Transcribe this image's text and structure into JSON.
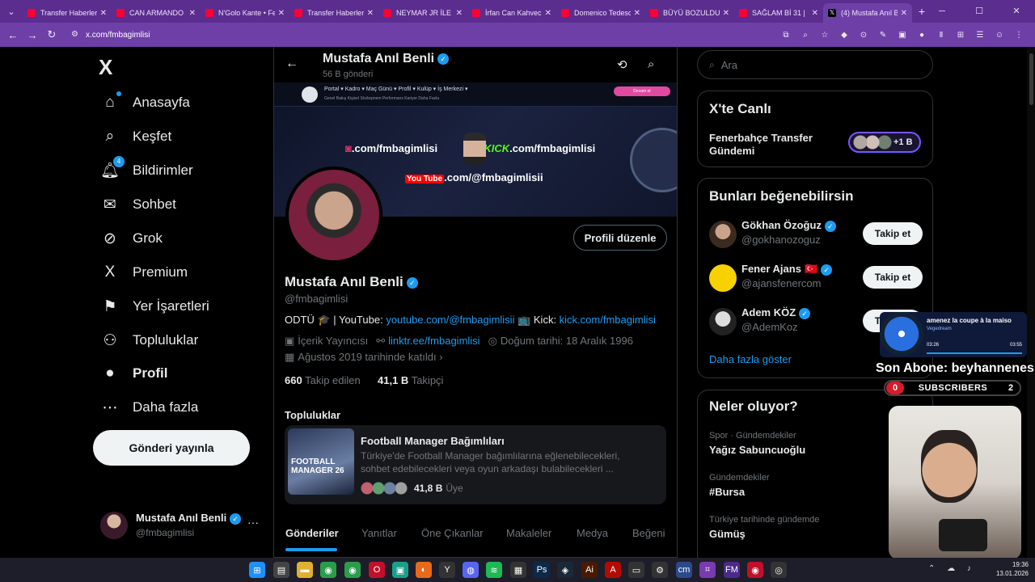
{
  "browser": {
    "tabs": [
      {
        "title": "Transfer Haberleri",
        "icon": "youtube-icon"
      },
      {
        "title": "CAN ARMANDO",
        "icon": "youtube-icon"
      },
      {
        "title": "N'Golo Kante • Fe",
        "icon": "youtube-icon"
      },
      {
        "title": "Transfer Haberleri",
        "icon": "youtube-icon"
      },
      {
        "title": "NEYMAR JR İLE B",
        "icon": "youtube-icon"
      },
      {
        "title": "İrfan Can Kahveci",
        "icon": "youtube-icon"
      },
      {
        "title": "Domenico Tedesc",
        "icon": "youtube-icon"
      },
      {
        "title": "BÜYÜ BOZULDU",
        "icon": "youtube-icon"
      },
      {
        "title": "SAĞLAM Bİ 31 |",
        "icon": "youtube-icon"
      },
      {
        "title": "(4) Mustafa Anıl B",
        "icon": "x-icon"
      }
    ],
    "active_tab": 9,
    "url": "x.com/fmbagimlisi",
    "accent": "#6f3fa8"
  },
  "sidebar": {
    "logo": "X",
    "items": [
      {
        "label": "Anasayfa",
        "icon": "home-icon"
      },
      {
        "label": "Keşfet",
        "icon": "search-icon"
      },
      {
        "label": "Bildirimler",
        "icon": "bell-icon",
        "badge": "4"
      },
      {
        "label": "Sohbet",
        "icon": "mail-icon"
      },
      {
        "label": "Grok",
        "icon": "grok-icon"
      },
      {
        "label": "Premium",
        "icon": "x-icon"
      },
      {
        "label": "Yer İşaretleri",
        "icon": "bookmark-icon"
      },
      {
        "label": "Topluluklar",
        "icon": "people-icon"
      },
      {
        "label": "Profil",
        "icon": "person-icon"
      },
      {
        "label": "Daha fazla",
        "icon": "more-circle-icon"
      }
    ],
    "post_button": "Gönderi yayınla",
    "account": {
      "name": "Mustafa Anıl Benli",
      "handle": "@fmbagimlisi",
      "more": "···"
    }
  },
  "profile": {
    "header_name": "Mustafa Anıl Benli",
    "post_count": "56 B gönderi",
    "banner": {
      "menu": "Portal ▾   Kadro ▾   Maç Günü ▾   Profil ▾   Kulüp ▾   İş Merkezi ▾",
      "submenu": "Genel Bakış   Kişisel   Sözleşmem   Performans   Kariyer   Daha Fazla",
      "button": "Devam et",
      "instagram": ".com/fmbagimlisi",
      "kick_brand": "KICK",
      "kick": ".com/fmbagimlisi",
      "youtube_brand": "You Tube",
      "youtube": ".com/@fmbagimlisii"
    },
    "edit_button": "Profili düzenle",
    "name": "Mustafa Anıl Benli",
    "handle": "@fmbagimlisi",
    "bio_prefix": "ODTÜ 🎓 | YouTube: ",
    "bio_youtube": "youtube.com/@fmbagimlisii",
    "bio_mid": " 📺 Kick: ",
    "bio_kick": "kick.com/fmbagimlisi",
    "category": "İçerik Yayıncısı",
    "link": "linktr.ee/fmbagimlisi",
    "birthday": "Doğum tarihi: 18 Aralık 1996",
    "joined": "Ağustos 2019 tarihinde katıldı",
    "following_count": "660",
    "following_label": "Takip edilen",
    "followers_count": "41,1 B",
    "followers_label": "Takipçi",
    "communities_heading": "Topluluklar",
    "community": {
      "title": "Football Manager Bağımlıları",
      "desc": "Türkiye'de Football Manager bağımlılarına eğlenebilecekleri, sohbet edebilecekleri veya oyun arkadaşı bulabilecekleri ...",
      "image_text": "FOOTBALL MANAGER 26",
      "members": "41,8 B",
      "members_label": "Üye"
    },
    "tabs": [
      "Gönderiler",
      "Yanıtlar",
      "Öne Çıkanlar",
      "Makaleler",
      "Medya",
      "Beğeni"
    ]
  },
  "right": {
    "search_placeholder": "Ara",
    "live": {
      "title": "X'te Canlı",
      "topic": "Fenerbahçe Transfer Gündemi",
      "count": "+1 B"
    },
    "suggestions": {
      "title": "Bunları beğenebilirsin",
      "items": [
        {
          "name": "Gökhan Özoğuz",
          "handle": "@gokhanozoguz",
          "button": "Takip et",
          "flag": ""
        },
        {
          "name": "Fener Ajans",
          "handle": "@ajansfenercom",
          "button": "Takip et",
          "flag": "🇹🇷"
        },
        {
          "name": "Adem KÖZ",
          "handle": "@AdemKoz",
          "button": "Takip et",
          "flag": ""
        }
      ],
      "more": "Daha fazla göster"
    },
    "trends": {
      "title": "Neler oluyor?",
      "items": [
        {
          "category": "Spor · Gündemdekiler",
          "topic": "Yağız Sabuncuoğlu"
        },
        {
          "category": "Gündemdekiler",
          "topic": "#Bursa"
        },
        {
          "category": "Türkiye tarihinde gündemde",
          "topic": "Gümüş"
        }
      ]
    }
  },
  "overlay": {
    "song": "amenez la coupe à la maiso",
    "artist": "Vegedream",
    "time_elapsed": "03:26",
    "time_total": "03:55",
    "last_sub": "Son Abone: beyhannenes",
    "sub_left": "0",
    "sub_label": "SUBSCRIBERS",
    "sub_right": "2"
  },
  "taskbar": {
    "time": "19:36",
    "date": "13.01.2026"
  }
}
